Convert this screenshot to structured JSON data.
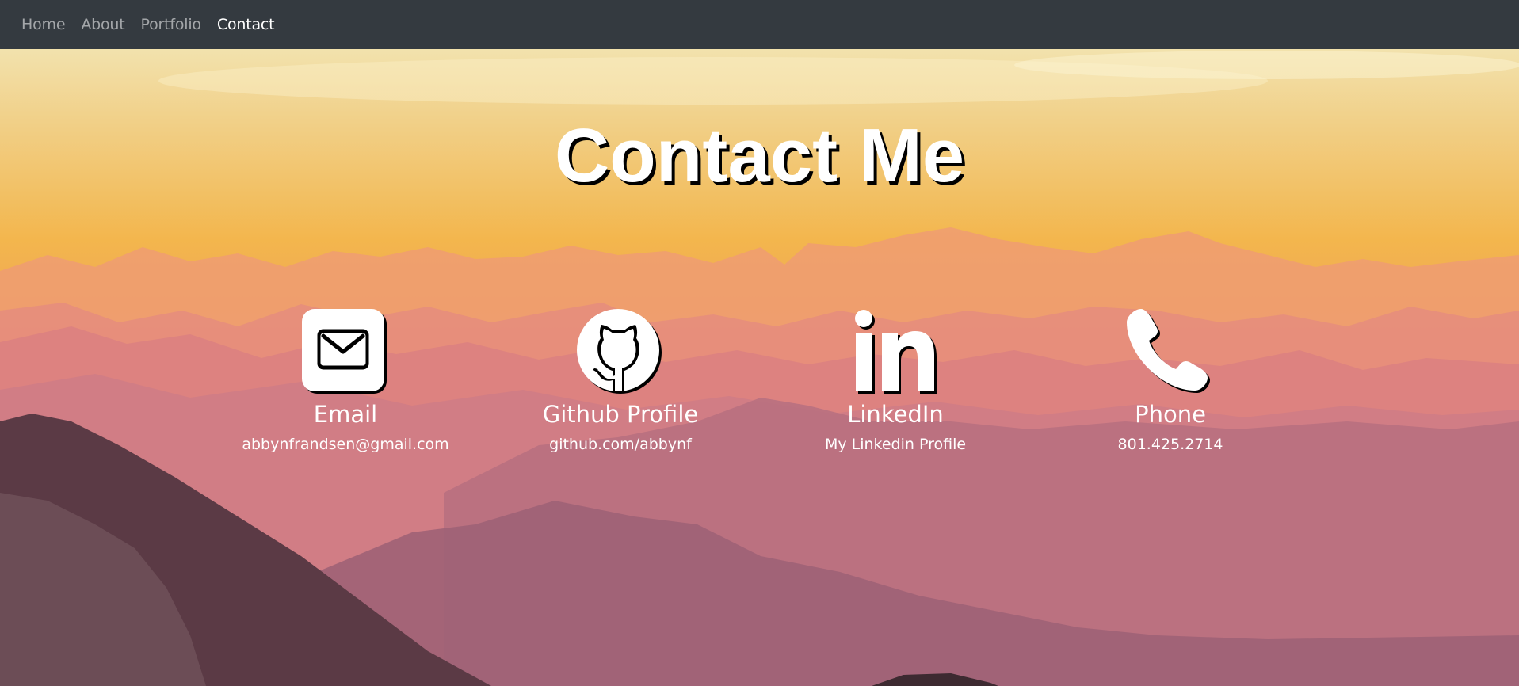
{
  "nav": {
    "items": [
      {
        "label": "Home",
        "active": false
      },
      {
        "label": "About",
        "active": false
      },
      {
        "label": "Portfolio",
        "active": false
      },
      {
        "label": "Contact",
        "active": true
      }
    ]
  },
  "hero": {
    "title": "Contact Me"
  },
  "contacts": [
    {
      "icon": "envelope-icon",
      "label": "Email",
      "value": "abbynfrandsen@gmail.com"
    },
    {
      "icon": "github-icon",
      "label": "Github Profile",
      "value": "github.com/abbynf"
    },
    {
      "icon": "linkedin-icon",
      "label": "LinkedIn",
      "value": "My Linkedin Profile"
    },
    {
      "icon": "phone-icon",
      "label": "Phone",
      "value": "801.425.2714"
    }
  ],
  "colors": {
    "navbar": "#343a40",
    "nav_inactive": "rgba(255,255,255,0.55)",
    "nav_active": "#ffffff",
    "text": "#ffffff",
    "shadow": "#000000"
  }
}
